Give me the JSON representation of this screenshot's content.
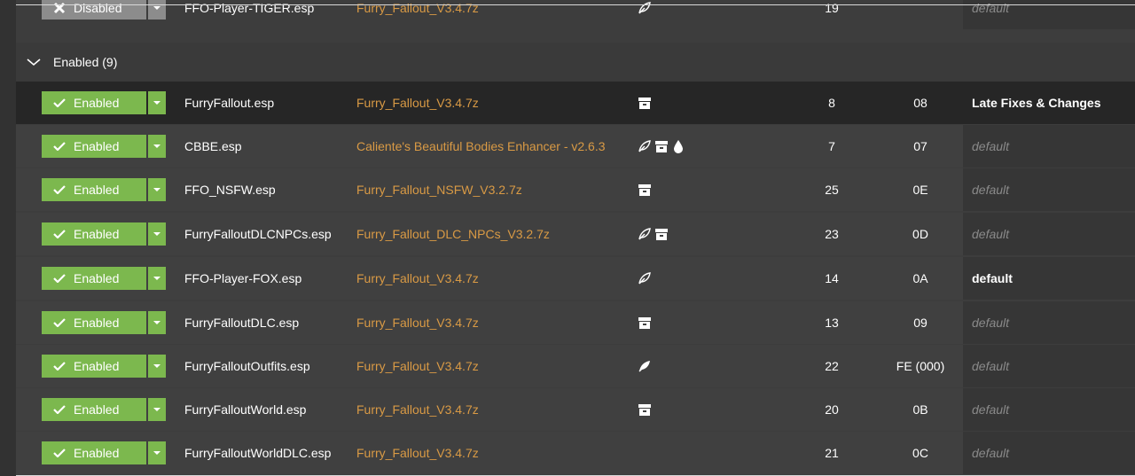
{
  "top_row": {
    "status": "Disabled",
    "name": "FFO-Player-TIGER.esp",
    "source": "Furry_Fallout_V3.4.7z",
    "priority": "19",
    "index": "",
    "category": "default"
  },
  "group": {
    "title": "Enabled (9)"
  },
  "rows": [
    {
      "status": "Enabled",
      "name": "FurryFallout.esp",
      "source": "Furry_Fallout_V3.4.7z",
      "flags": [
        "archive-icon"
      ],
      "priority": "8",
      "index": "08",
      "category": "Late Fixes & Changes"
    },
    {
      "status": "Enabled",
      "name": "CBBE.esp",
      "source": "Caliente's Beautiful Bodies Enhancer - v2.6.3",
      "flags": [
        "leaf-icon",
        "archive-icon",
        "drop-icon"
      ],
      "priority": "7",
      "index": "07",
      "category": "default"
    },
    {
      "status": "Enabled",
      "name": "FFO_NSFW.esp",
      "source": "Furry_Fallout_NSFW_V3.2.7z",
      "flags": [
        "archive-icon"
      ],
      "priority": "25",
      "index": "0E",
      "category": "default"
    },
    {
      "status": "Enabled",
      "name": "FurryFalloutDLCNPCs.esp",
      "source": "Furry_Fallout_DLC_NPCs_V3.2.7z",
      "flags": [
        "leaf-icon",
        "archive-icon"
      ],
      "priority": "23",
      "index": "0D",
      "category": "default"
    },
    {
      "status": "Enabled",
      "name": "FFO-Player-FOX.esp",
      "source": "Furry_Fallout_V3.4.7z",
      "flags": [
        "leaf-icon"
      ],
      "priority": "14",
      "index": "0A",
      "category": "default"
    },
    {
      "status": "Enabled",
      "name": "FurryFalloutDLC.esp",
      "source": "Furry_Fallout_V3.4.7z",
      "flags": [
        "archive-icon"
      ],
      "priority": "13",
      "index": "09",
      "category": "default"
    },
    {
      "status": "Enabled",
      "name": "FurryFalloutOutfits.esp",
      "source": "Furry_Fallout_V3.4.7z",
      "flags": [
        "leaf-filled-icon"
      ],
      "priority": "22",
      "index": "FE (000)",
      "category": "default"
    },
    {
      "status": "Enabled",
      "name": "FurryFalloutWorld.esp",
      "source": "Furry_Fallout_V3.4.7z",
      "flags": [
        "archive-icon"
      ],
      "priority": "20",
      "index": "0B",
      "category": "default"
    },
    {
      "status": "Enabled",
      "name": "FurryFalloutWorldDLC.esp",
      "source": "Furry_Fallout_V3.4.7z",
      "flags": [],
      "priority": "21",
      "index": "0C",
      "category": "default"
    }
  ],
  "colors": {
    "enabled_green": "#7cb84e",
    "disabled_grey": "#8c8c8c",
    "source_orange": "#d99a45",
    "selected_row": "#262626"
  }
}
